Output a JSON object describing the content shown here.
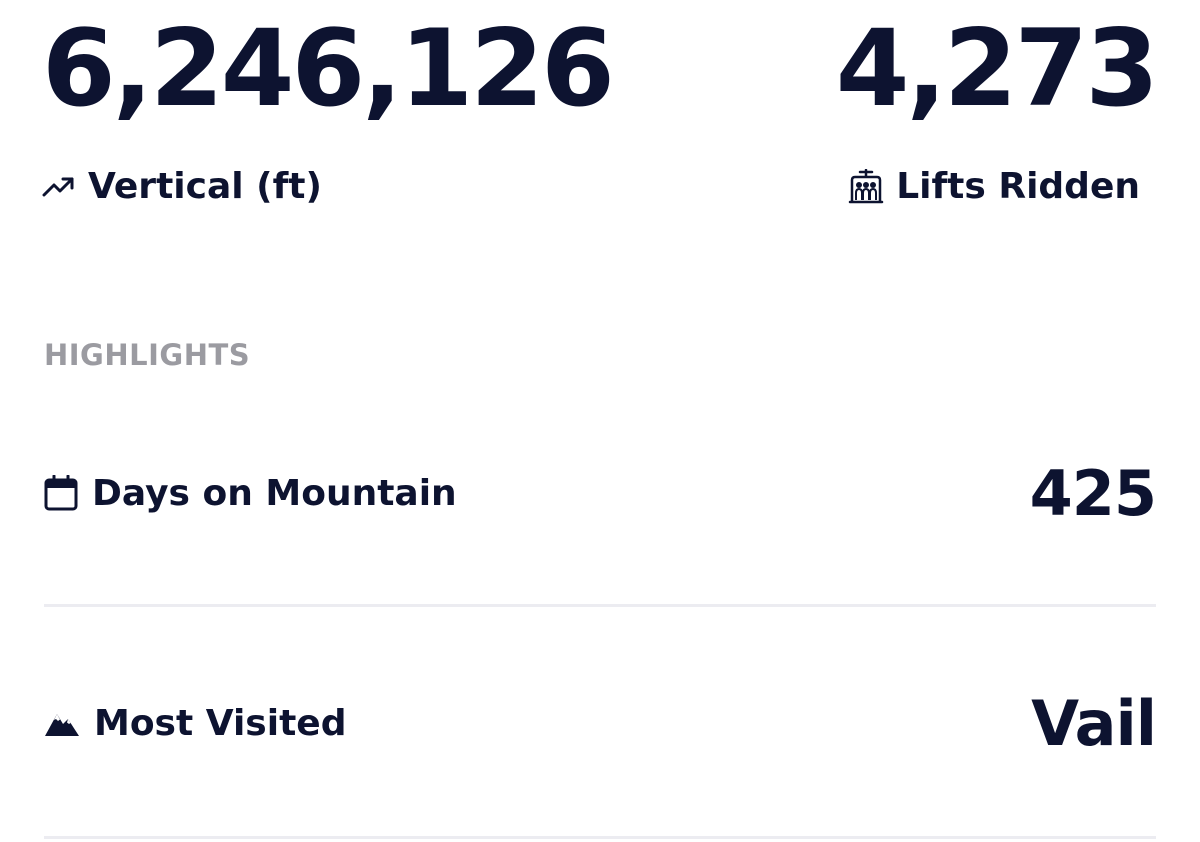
{
  "stats": {
    "vertical": {
      "value": "6,246,126",
      "label": "Vertical (ft)",
      "icon": "trending-up-icon"
    },
    "lifts": {
      "value": "4,273",
      "label": "Lifts Ridden",
      "icon": "chairlift-icon"
    }
  },
  "highlights": {
    "title": "HIGHLIGHTS",
    "items": [
      {
        "label": "Days on Mountain",
        "value": "425",
        "icon": "calendar-icon"
      },
      {
        "label": "Most Visited",
        "value": "Vail",
        "icon": "mountain-icon"
      }
    ]
  },
  "colors": {
    "text": "#0d1330",
    "muted": "#9b9ba1",
    "divider": "#ececf1",
    "background": "#ffffff"
  }
}
